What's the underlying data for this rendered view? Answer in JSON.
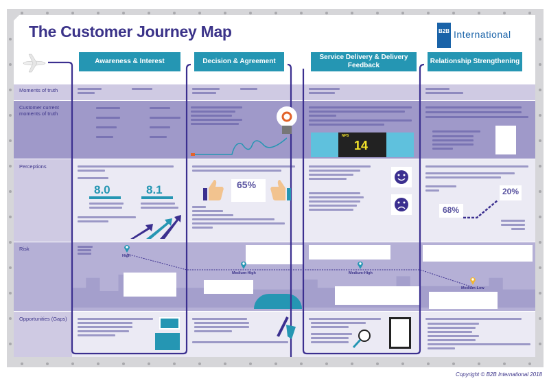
{
  "header": {
    "title": "The Customer Journey Map",
    "logo_mark": "B2B",
    "logo_text": "International"
  },
  "stages": [
    "Awareness & Interest",
    "Decision & Agreement",
    "Service Delivery & Delivery Feedback",
    "Relationship Strengthening"
  ],
  "rows": [
    "Moments of truth",
    "Customer current moments of truth",
    "Perceptions",
    "Risk",
    "Opportunities (Gaps)"
  ],
  "perceptions": {
    "score_1": "8.0",
    "score_2": "8.1",
    "percent_65": "65%",
    "percent_20": "20%",
    "percent_68": "68%"
  },
  "nps": {
    "label": "NPS",
    "value": "14"
  },
  "risk": {
    "levels": [
      "High",
      "Medium-High",
      "Medium-High",
      "Medium-Low"
    ]
  },
  "icons": [
    "plane-icon",
    "lightbulb-icon",
    "thumbs-up-icon",
    "smiley-icon",
    "sad-face-icon",
    "map-pin-icon",
    "megaphone-icon",
    "magnifier-icon",
    "tablet-chart-icon"
  ],
  "colors": {
    "brand_purple": "#3b3389",
    "stage_teal": "#2596b3",
    "logo_blue": "#1a63a8"
  },
  "copyright": "Copyright © B2B International 2018"
}
